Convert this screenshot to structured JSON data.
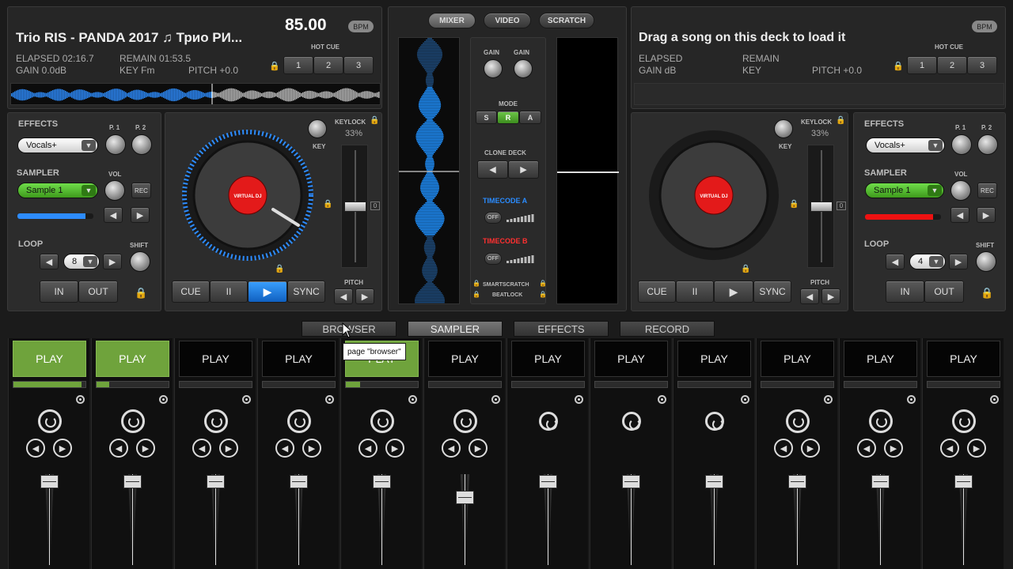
{
  "deckA": {
    "title": "Trio RIS - PANDA 2017 ♫ Трио РИ...",
    "bpm": "85.00",
    "bpm_badge": "BPM",
    "elapsed": "ELAPSED 02:16.7",
    "remain": "REMAIN 01:53.5",
    "gain": "GAIN 0.0dB",
    "key": "KEY Fm",
    "pitch": "PITCH +0.0",
    "hot_cue_label": "HOT CUE",
    "hot_cues": [
      "1",
      "2",
      "3"
    ],
    "effects_label": "EFFECTS",
    "effect_value": "Vocals+",
    "p1": "P. 1",
    "p2": "P. 2",
    "sampler_label": "SAMPLER",
    "vol": "VOL",
    "sampler_value": "Sample 1",
    "rec": "REC",
    "loop_label": "LOOP",
    "shift": "SHIFT",
    "loop_value": "8",
    "in": "IN",
    "out": "OUT",
    "key_label": "KEY",
    "keylock": "KEYLOCK",
    "keylock_pct": "33%",
    "pitch_label": "PITCH",
    "cue": "CUE",
    "pause": "II",
    "play": "▶",
    "sync": "SYNC",
    "zero": "0",
    "sampler_level": 0.9,
    "platter_label": "VIRTUAL DJ"
  },
  "deckB": {
    "title": "Drag a song on this deck to load it",
    "bpm_badge": "BPM",
    "elapsed": "ELAPSED",
    "remain": "REMAIN",
    "gain": "GAIN dB",
    "key": "KEY",
    "pitch": "PITCH +0.0",
    "hot_cue_label": "HOT CUE",
    "hot_cues": [
      "1",
      "2",
      "3"
    ],
    "effects_label": "EFFECTS",
    "effect_value": "Vocals+",
    "p1": "P. 1",
    "p2": "P. 2",
    "sampler_label": "SAMPLER",
    "vol": "VOL",
    "sampler_value": "Sample 1",
    "rec": "REC",
    "loop_label": "LOOP",
    "shift": "SHIFT",
    "loop_value": "4",
    "in": "IN",
    "out": "OUT",
    "key_label": "KEY",
    "keylock": "KEYLOCK",
    "keylock_pct": "33%",
    "pitch_label": "PITCH",
    "cue": "CUE",
    "pause": "II",
    "play": "▶",
    "sync": "SYNC",
    "zero": "0",
    "sampler_level": 0.9,
    "platter_label": "VIRTUAL DJ"
  },
  "mixer": {
    "tabs": [
      "MIXER",
      "VIDEO",
      "SCRATCH"
    ],
    "gain1": "GAIN",
    "gain2": "GAIN",
    "mode": "MODE",
    "mode_buttons": [
      "S",
      "R",
      "A"
    ],
    "clone_deck": "CLONE DECK",
    "timecode_a": "TIMECODE A",
    "timecode_b": "TIMECODE B",
    "off": "OFF",
    "smartscratch": "SMARTSCRATCH",
    "beatlock": "BEATLOCK"
  },
  "bottom_tabs": [
    "BROWSER",
    "SAMPLER",
    "EFFECTS",
    "RECORD"
  ],
  "tooltip": "page \"browser\"",
  "samples": [
    {
      "label": "PLAY",
      "active": true,
      "progress": 0.95
    },
    {
      "label": "PLAY",
      "active": true,
      "progress": 0.18
    },
    {
      "label": "PLAY",
      "active": false,
      "progress": 0
    },
    {
      "label": "PLAY",
      "active": false,
      "progress": 0
    },
    {
      "label": "PLAY",
      "active": true,
      "progress": 0.2
    },
    {
      "label": "PLAY",
      "active": false,
      "progress": 0
    },
    {
      "label": "PLAY",
      "active": false,
      "progress": 0
    },
    {
      "label": "PLAY",
      "active": false,
      "progress": 0
    },
    {
      "label": "PLAY",
      "active": false,
      "progress": 0
    },
    {
      "label": "PLAY",
      "active": false,
      "progress": 0
    },
    {
      "label": "PLAY",
      "active": false,
      "progress": 0
    },
    {
      "label": "PLAY",
      "active": false,
      "progress": 0
    }
  ],
  "colors": {
    "accent_blue": "#1e90ff",
    "sample_green": "#6fa33c",
    "rec_red": "#e11",
    "timecode_a": "#2a8cff",
    "timecode_b": "#ff3030"
  }
}
